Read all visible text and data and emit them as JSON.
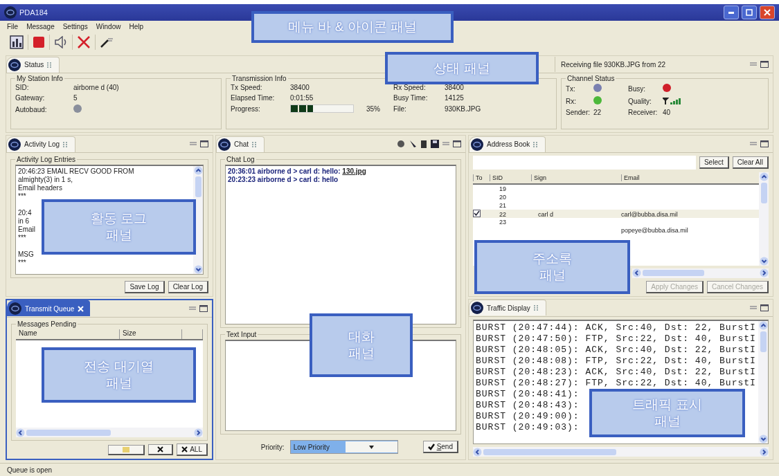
{
  "window": {
    "title": "PDA184"
  },
  "menu": [
    "File",
    "Message",
    "Settings",
    "Window",
    "Help"
  ],
  "status_panel": {
    "tab": {
      "label": "Status",
      "selected": false
    },
    "message": "Receiving file 930KB.JPG from 22",
    "station": {
      "title": "My Station Info",
      "fields": [
        {
          "kind": "text",
          "label": "SID:",
          "value": "airborne d (40)"
        },
        {
          "kind": "text",
          "label": "Gateway:",
          "value": "5"
        },
        {
          "kind": "dot",
          "label": "Autobaud:",
          "color": "#8a8f9c"
        }
      ]
    },
    "transmission": {
      "title": "Transmission Info",
      "left": [
        {
          "kind": "text",
          "label": "Tx Speed:",
          "value": "38400"
        },
        {
          "kind": "text",
          "label": "Elapsed Time:",
          "value": "0:01:55"
        },
        {
          "kind": "progress",
          "label": "Progress:",
          "level": 0.35,
          "reading": "35%"
        }
      ],
      "right": [
        {
          "kind": "text",
          "label": "Rx Speed:",
          "value": "38400"
        },
        {
          "kind": "text",
          "label": "Busy Time:",
          "value": "14125"
        },
        {
          "kind": "text",
          "label": "File:",
          "value": "930KB.JPG"
        }
      ]
    },
    "channel": {
      "title": "Channel Status",
      "items": [
        {
          "kind": "dot",
          "label": "Tx:",
          "color": "#7a80b0"
        },
        {
          "kind": "dot",
          "label": "Busy:",
          "color": "#d0202a"
        },
        {
          "kind": "dot",
          "label": "Rx:",
          "color": "#4cb83a"
        },
        {
          "kind": "signal",
          "label": "Quality:"
        },
        {
          "kind": "text",
          "label": "Sender:",
          "value": "22"
        },
        {
          "kind": "text",
          "label": "Receiver:",
          "value": "40"
        }
      ]
    }
  },
  "activity_log": {
    "tab": {
      "label": "Activity Log",
      "selected": false
    },
    "group": "Activity Log Entries",
    "entries": [
      [
        "20:46:23 EMAIL RECV GOOD FROM",
        "almighty(3) in 1 s,",
        "Email headers",
        "***"
      ],
      [
        "20:4",
        "in 6",
        "Email",
        "***"
      ],
      [
        "MSG",
        "***"
      ]
    ],
    "buttons": [
      "Save Log",
      "Clear Log"
    ]
  },
  "transmit_queue": {
    "tab": {
      "label": "Transmit Queue",
      "selected": true
    },
    "group": "Messages Pending",
    "columns": [
      "Name",
      "Size"
    ],
    "all_label": "ALL"
  },
  "chat": {
    "tab": {
      "label": "Chat",
      "selected": false
    },
    "log_title": "Chat Log",
    "lines": [
      {
        "text": "20:36:01 airborne d > carl d: hello: ",
        "link": "130.jpg"
      },
      {
        "text": "20:23:23 airborne d > carl d: hello"
      }
    ],
    "input_title": "Text Input",
    "priority": {
      "label": "Priority:",
      "value": "Low Priority"
    },
    "send": "Send"
  },
  "address_book": {
    "tab": {
      "label": "Address Book",
      "selected": false
    },
    "buttons": [
      {
        "label": "Select",
        "disabled": false
      },
      {
        "label": "Clear All",
        "disabled": false
      }
    ],
    "columns": [
      "To",
      "SID",
      "Sign",
      "Email"
    ],
    "rows": [
      {
        "sid": "19",
        "checked": false,
        "selected": false
      },
      {
        "sid": "20",
        "checked": false,
        "selected": false
      },
      {
        "sid": "21",
        "checked": false,
        "selected": false
      },
      {
        "sid": "22",
        "sign": "carl d",
        "email": "carl@bubba.disa.mil",
        "checked": true,
        "selected": true
      },
      {
        "sid": "23",
        "checked": false,
        "selected": false
      },
      {
        "email": "popeye@bubba.disa.mil",
        "checked": false,
        "selected": false
      }
    ],
    "footer_buttons": [
      {
        "label": "Apply Changes",
        "disabled": true
      },
      {
        "label": "Cancel Changes",
        "disabled": true
      }
    ]
  },
  "traffic_display": {
    "tab": {
      "label": "Traffic Display",
      "selected": false
    },
    "lines": [
      "BURST (20:47:44): ACK, Src:40, Dst: 22, BurstI",
      "BURST (20:47:50): FTP, Src:22, Dst: 40, BurstI",
      "BURST (20:48:05): ACK, Src:40, Dst: 22, BurstI",
      "BURST (20:48:08): FTP, Src:22, Dst: 40, BurstI",
      "BURST (20:48:23): ACK, Src:40, Dst: 22, BurstI",
      "BURST (20:48:27): FTP, Src:22, Dst: 40, BurstI",
      "BURST (20:48:41):",
      "BURST (20:48:43):",
      "BURST (20:49:00):",
      "BURST (20:49:03):"
    ]
  },
  "status_bar": "Queue is open",
  "annotations": [
    {
      "lines": [
        "메뉴 바 & 아이콘 패널"
      ]
    },
    {
      "lines": [
        "상태 패널"
      ]
    },
    {
      "lines": [
        "활동 로그",
        "패널"
      ]
    },
    {
      "lines": [
        "대화",
        "패널"
      ]
    },
    {
      "lines": [
        "전송 대기열",
        "패널"
      ]
    },
    {
      "lines": [
        "주소록",
        "패널"
      ]
    },
    {
      "lines": [
        "트래픽 표시",
        "패널"
      ]
    }
  ]
}
